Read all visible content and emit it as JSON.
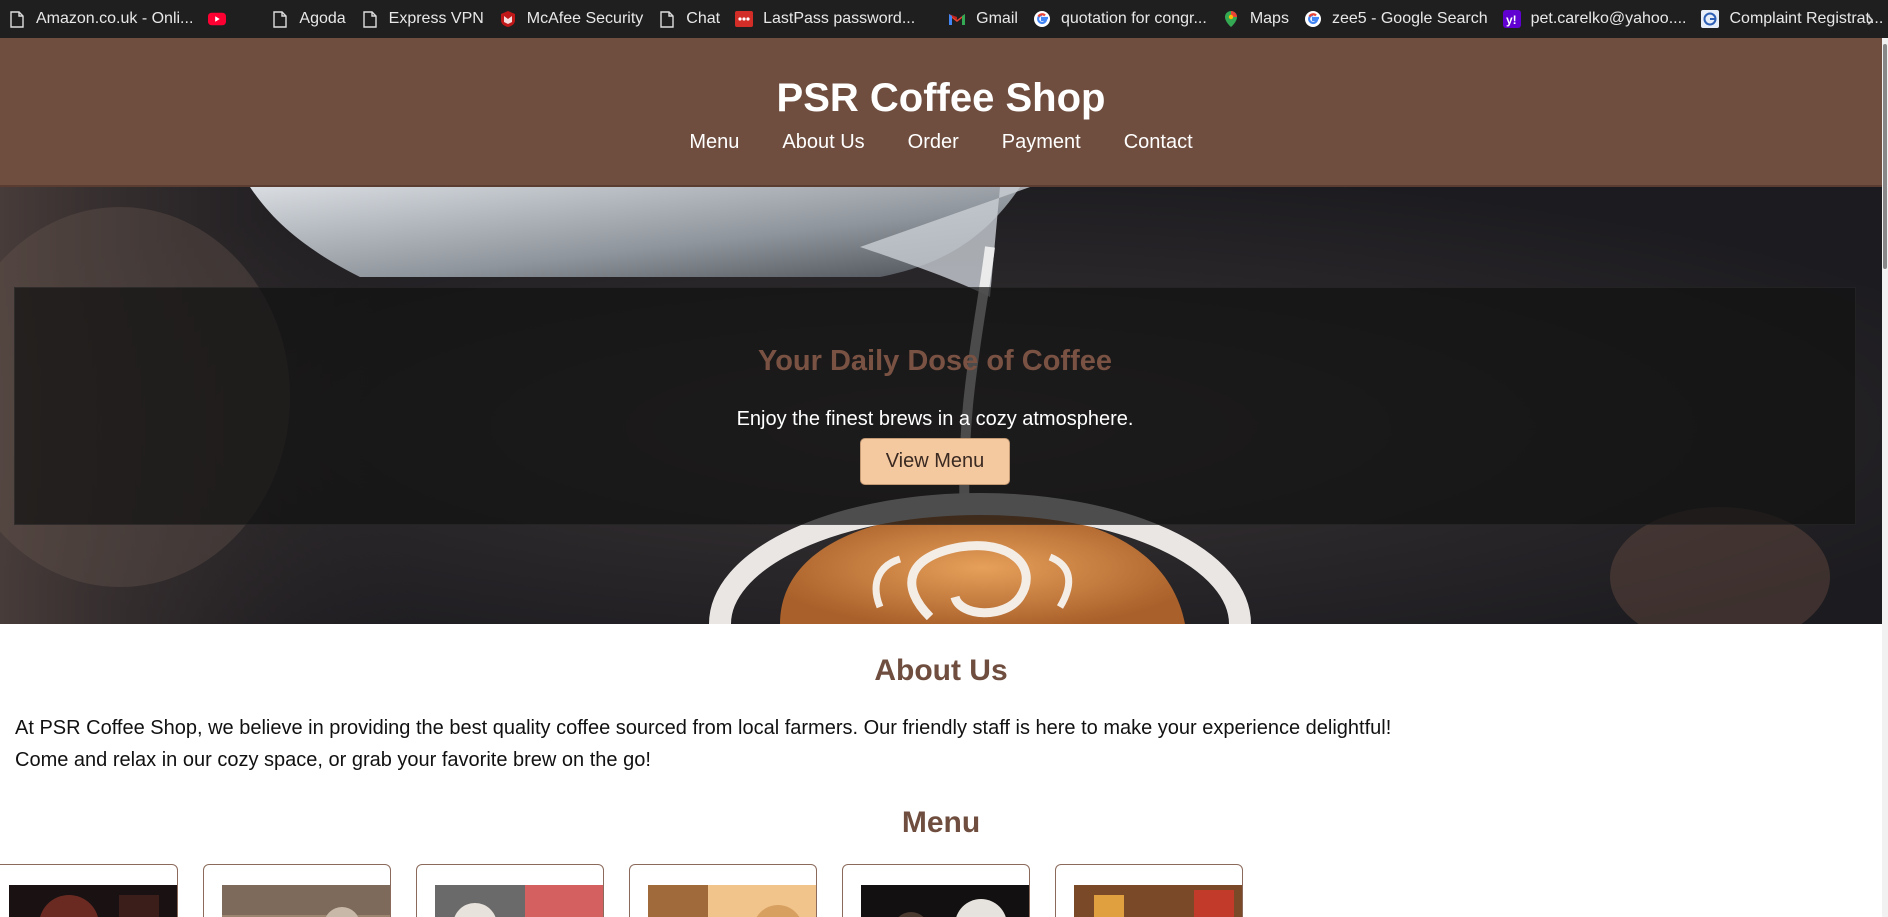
{
  "bookmarks": [
    {
      "label": "Amazon.co.uk - Onli...",
      "icon": "page-icon"
    },
    {
      "label": "",
      "icon": "youtube-icon"
    },
    {
      "label": "Agoda",
      "icon": "page-icon"
    },
    {
      "label": "Express VPN",
      "icon": "page-icon"
    },
    {
      "label": "McAfee Security",
      "icon": "mcafee-icon"
    },
    {
      "label": "Chat",
      "icon": "page-icon"
    },
    {
      "label": "LastPass password...",
      "icon": "lastpass-icon"
    },
    {
      "label": "Gmail",
      "icon": "gmail-icon"
    },
    {
      "label": "quotation for congr...",
      "icon": "google-icon"
    },
    {
      "label": "Maps",
      "icon": "maps-icon"
    },
    {
      "label": "zee5 - Google Search",
      "icon": "google-icon"
    },
    {
      "label": "pet.carelko@yahoo....",
      "icon": "yahoo-icon"
    },
    {
      "label": "Complaint Registrat...",
      "icon": "complaint-icon"
    }
  ],
  "header": {
    "title": "PSR Coffee Shop",
    "nav": [
      "Menu",
      "About Us",
      "Order",
      "Payment",
      "Contact"
    ]
  },
  "hero": {
    "title": "Your Daily Dose of Coffee",
    "subtitle": "Enjoy the finest brews in a cozy atmosphere.",
    "button": "View Menu"
  },
  "about": {
    "heading": "About Us",
    "text": "At PSR Coffee Shop, we believe in providing the best quality coffee sourced from local farmers. Our friendly staff is here to make your experience delightful! Come and relax in our cozy space, or grab your favorite brew on the go!"
  },
  "menu": {
    "heading": "Menu",
    "cards": 6
  },
  "colors": {
    "brand": "#6f4e3f",
    "button": "#f5c9a0",
    "bookmarks_bar": "#1f1f1f"
  }
}
